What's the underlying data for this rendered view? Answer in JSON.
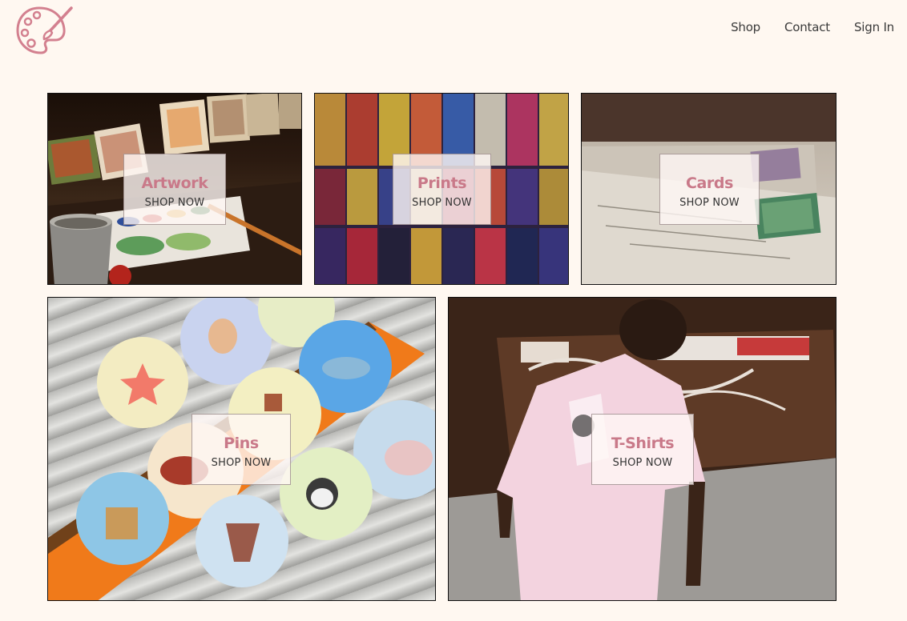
{
  "nav": {
    "items": [
      {
        "label": "Shop"
      },
      {
        "label": "Contact"
      },
      {
        "label": "Sign In"
      }
    ]
  },
  "categories": [
    {
      "title": "Artwork",
      "cta": "SHOP NOW"
    },
    {
      "title": "Prints",
      "cta": "SHOP NOW"
    },
    {
      "title": "Cards",
      "cta": "SHOP NOW"
    },
    {
      "title": "Pins",
      "cta": "SHOP NOW"
    },
    {
      "title": "T-Shirts",
      "cta": "SHOP NOW"
    }
  ],
  "colors": {
    "background": "#fff8f1",
    "accent": "#c97989",
    "logo": "#d3808f"
  }
}
